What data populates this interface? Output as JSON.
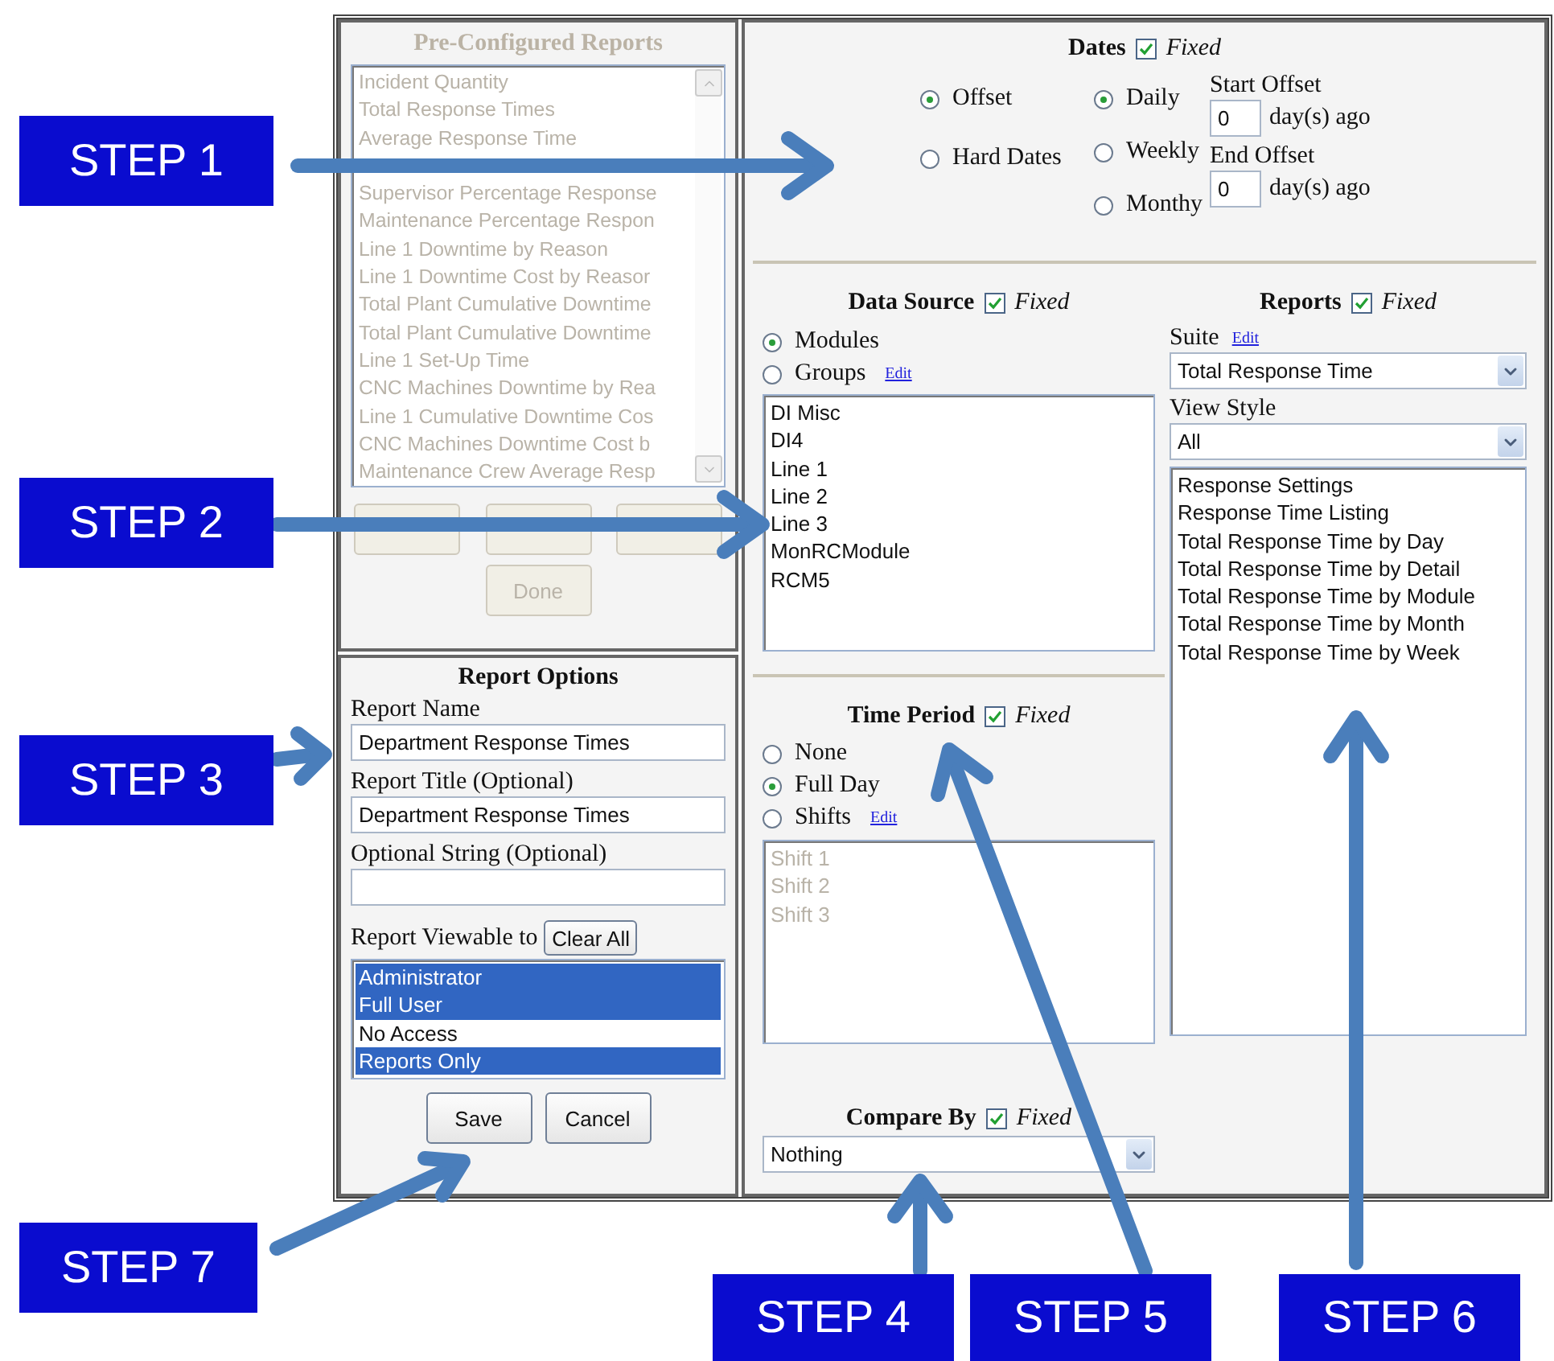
{
  "pre_configured_reports": {
    "title": "Pre-Configured Reports",
    "disabled": true,
    "items": [
      "Incident Quantity",
      "Total Response Times",
      "Average Response Time",
      "Supervisor Percentage Response",
      "Maintenance Percentage Respon",
      "Line 1 Downtime by Reason",
      "Line 1 Downtime Cost by Reasor",
      "Total Plant Cumulative Downtime",
      "Total Plant Cumulative Downtime",
      "Line 1 Set-Up Time",
      "CNC Machines Downtime by Rea",
      "Line 1 Cumulative Downtime Cos",
      "CNC Machines Downtime Cost b",
      "Maintenance Crew Average Resp"
    ],
    "done_button": "Done"
  },
  "report_options": {
    "title": "Report Options",
    "fields": [
      {
        "label": "Report Name",
        "value": "Department Response Times"
      },
      {
        "label": "Report Title (Optional)",
        "value": "Department Response Times"
      },
      {
        "label": "Optional String (Optional)"
      }
    ],
    "viewable_label": "Report Viewable to",
    "clear_button": "Clear All",
    "roles": [
      {
        "label": "Administrator",
        "selected": true
      },
      {
        "label": "Full User",
        "selected": true
      },
      {
        "label": "No Access",
        "selected": false
      },
      {
        "label": "Reports Only",
        "selected": true
      }
    ],
    "buttons": [
      "Save",
      "Cancel"
    ]
  },
  "dates": {
    "title": "Dates",
    "fixed": true,
    "fixed_label": "Fixed",
    "modes": [
      {
        "label": "Offset",
        "selected": true
      },
      {
        "label": "Hard Dates",
        "selected": false
      }
    ],
    "periods": [
      {
        "label": "Daily",
        "selected": true
      },
      {
        "label": "Weekly",
        "selected": false
      },
      {
        "label": "Monthy",
        "selected": false
      }
    ],
    "offsets": [
      {
        "label": "Start Offset",
        "value": "0",
        "suffix": "day(s) ago"
      },
      {
        "label": "End Offset",
        "value": "0",
        "suffix": "day(s) ago"
      }
    ]
  },
  "data_source": {
    "title": "Data Source",
    "fixed": true,
    "fixed_label": "Fixed",
    "options": [
      {
        "label": "Modules",
        "selected": true
      },
      {
        "label": "Groups",
        "selected": false,
        "edit_link": "Edit"
      }
    ],
    "items": [
      "DI Misc",
      "DI4",
      "Line 1",
      "Line 2",
      "Line 3",
      "MonRCModule",
      "RCM5"
    ]
  },
  "time_period": {
    "title": "Time Period",
    "fixed": true,
    "fixed_label": "Fixed",
    "options": [
      {
        "label": "None",
        "selected": false
      },
      {
        "label": "Full Day",
        "selected": true
      },
      {
        "label": "Shifts",
        "selected": false,
        "edit_link": "Edit"
      }
    ],
    "shifts_disabled": true,
    "shifts": [
      "Shift 1",
      "Shift 2",
      "Shift 3"
    ]
  },
  "compare_by": {
    "title": "Compare By",
    "fixed": true,
    "fixed_label": "Fixed",
    "value": "Nothing"
  },
  "reports": {
    "title": "Reports",
    "fixed": true,
    "fixed_label": "Fixed",
    "suite_label": "Suite",
    "suite_edit": "Edit",
    "suite_value": "Total Response Time",
    "view_style_label": "View Style",
    "view_style_value": "All",
    "items": [
      "Response Settings",
      "Response Time Listing",
      "Total Response Time by Day",
      "Total Response Time by Detail",
      "Total Response Time by Module",
      "Total Response Time by Month",
      "Total Response Time by Week"
    ]
  },
  "annotations": [
    {
      "label": "STEP 1"
    },
    {
      "label": "STEP 2"
    },
    {
      "label": "STEP 3"
    },
    {
      "label": "STEP 7"
    },
    {
      "label": "STEP 4"
    },
    {
      "label": "STEP 5"
    },
    {
      "label": "STEP 6"
    }
  ]
}
